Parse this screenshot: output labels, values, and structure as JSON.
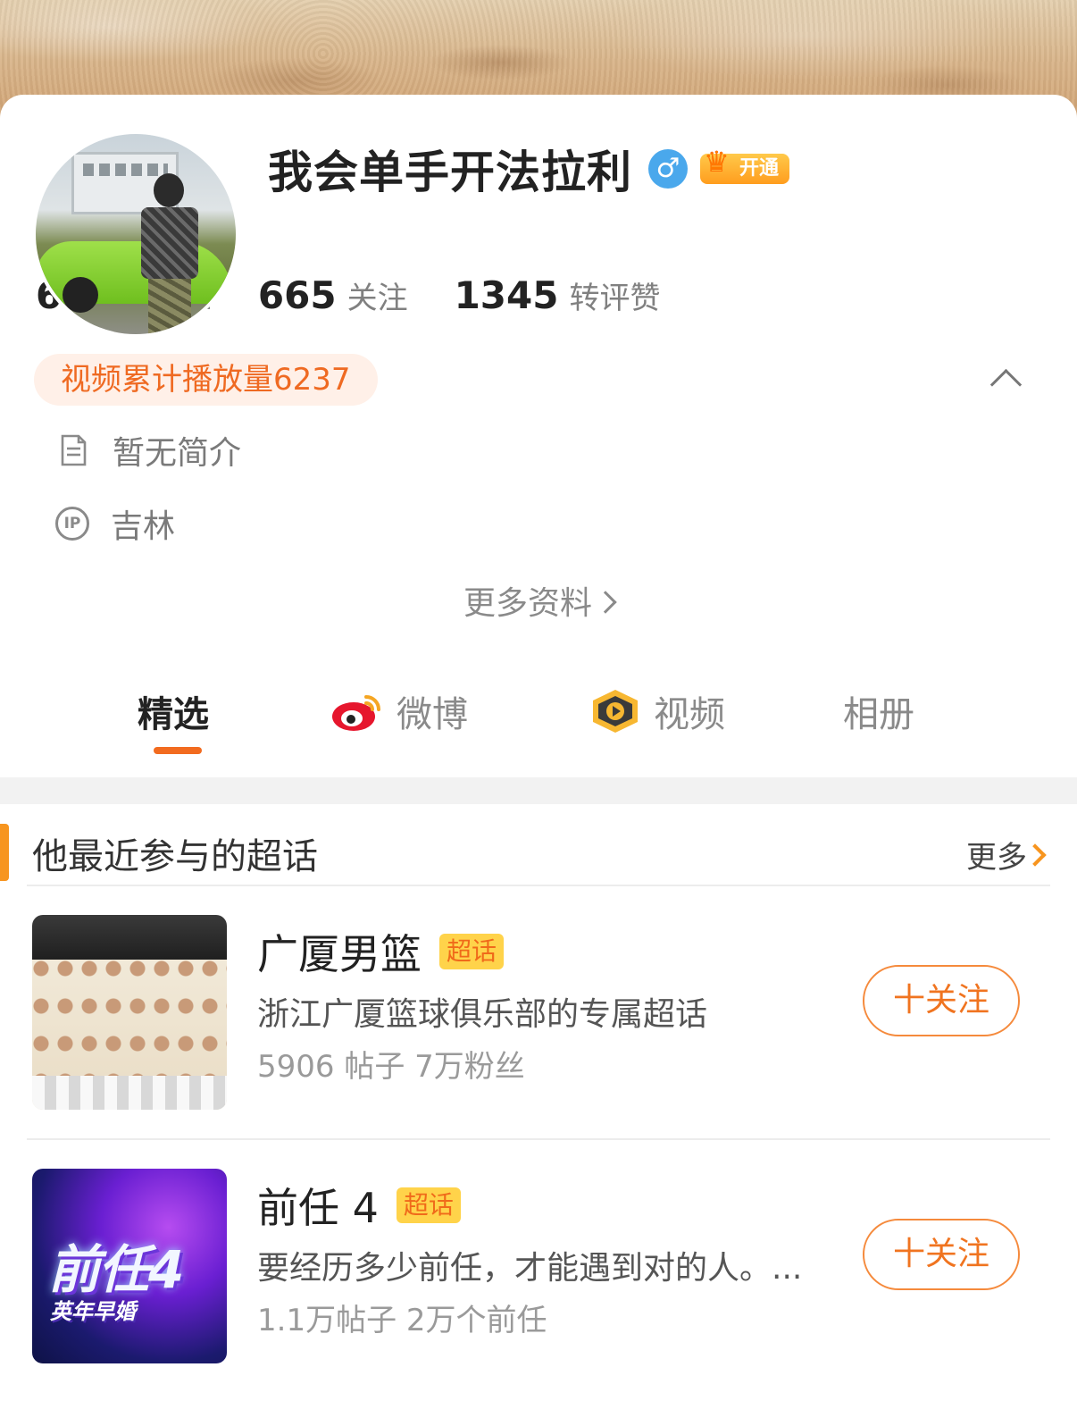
{
  "profile": {
    "name": "我会单手开法拉利",
    "gender_symbol": "♂",
    "vip_label": "开通",
    "stats": [
      {
        "num": "6198",
        "label": "粉丝"
      },
      {
        "num": "665",
        "label": "关注"
      },
      {
        "num": "1345",
        "label": "转评赞"
      }
    ],
    "play_badge": "视频累计播放量6237",
    "bio": "暂无简介",
    "ip_icon_text": "IP",
    "location": "吉林",
    "more_info": "更多资料"
  },
  "tabs": [
    {
      "label": "精选"
    },
    {
      "label": "微博"
    },
    {
      "label": "视频"
    },
    {
      "label": "相册"
    }
  ],
  "supertopics": {
    "title": "他最近参与的超话",
    "more": "更多",
    "items": [
      {
        "title": "广厦男篮",
        "tag": "超话",
        "desc": "浙江广厦篮球俱乐部的专属超话",
        "meta": "5906 帖子 7万粉丝",
        "button": "十关注"
      },
      {
        "title": "前任 4",
        "tag": "超话",
        "desc": "要经历多少前任，才能遇到对的人。...",
        "meta": "1.1万帖子 2万个前任",
        "button": "十关注",
        "thumb_logo": "前任4",
        "thumb_sub": "英年早婚"
      }
    ]
  },
  "colors": {
    "accent": "#f26b1f",
    "tag_bg": "#ffd34a",
    "gender_blue": "#4aa8ec"
  }
}
